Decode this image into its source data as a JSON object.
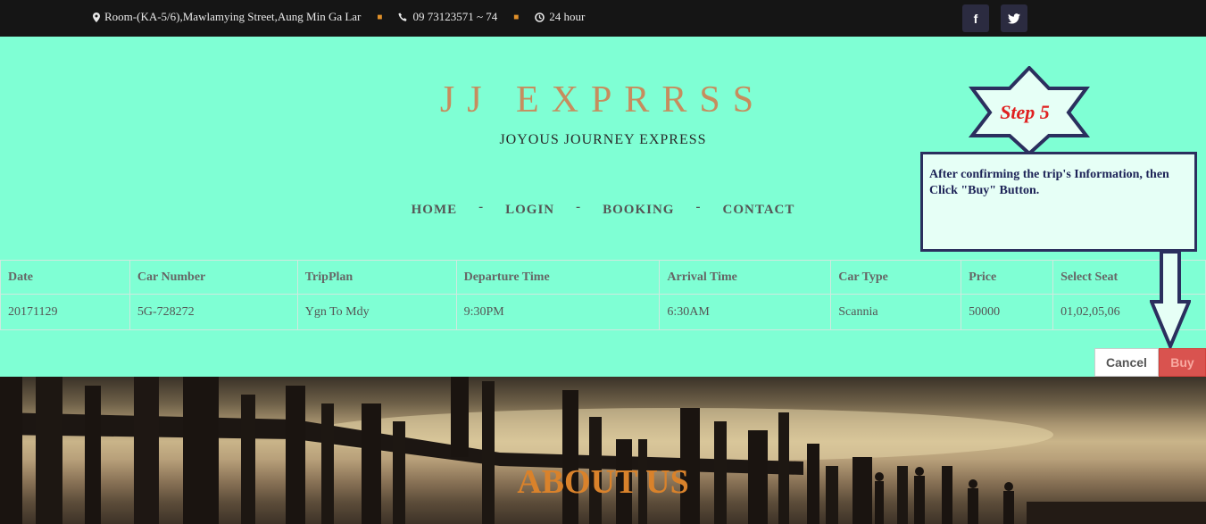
{
  "topbar": {
    "address": "Room-(KA-5/6),Mawlamying Street,Aung Min Ga Lar",
    "phone": "09 73123571 ~ 74",
    "hours": "24 hour",
    "facebook_glyph": "f",
    "twitter_glyph": "t"
  },
  "header": {
    "brand": "JJ EXPRRSS",
    "tagline": "JOYOUS JOURNEY EXPRESS"
  },
  "nav": {
    "items": [
      "HOME",
      "LOGIN",
      "BOOKING",
      "CONTACT"
    ],
    "separator": "-"
  },
  "table": {
    "headers": [
      "Date",
      "Car Number",
      "TripPlan",
      "Departure Time",
      "Arrival Time",
      "Car Type",
      "Price",
      "Select Seat"
    ],
    "rows": [
      [
        "20171129",
        "5G-728272",
        "Ygn To Mdy",
        "9:30PM",
        "6:30AM",
        "Scannia",
        "50000",
        "01,02,05,06"
      ]
    ]
  },
  "actions": {
    "cancel_label": "Cancel",
    "buy_label": "Buy"
  },
  "about": {
    "title": "ABOUT US"
  },
  "annotation": {
    "step": "Step 5",
    "text": "After confirming the trip's Information, then Click \"Buy\" Button."
  },
  "colors": {
    "background": "#7fffd4",
    "topbar": "#151515",
    "brand": "#c68d5e",
    "buy_button": "#d9534f",
    "about_title": "#d9822b",
    "step_text": "#e02020"
  }
}
